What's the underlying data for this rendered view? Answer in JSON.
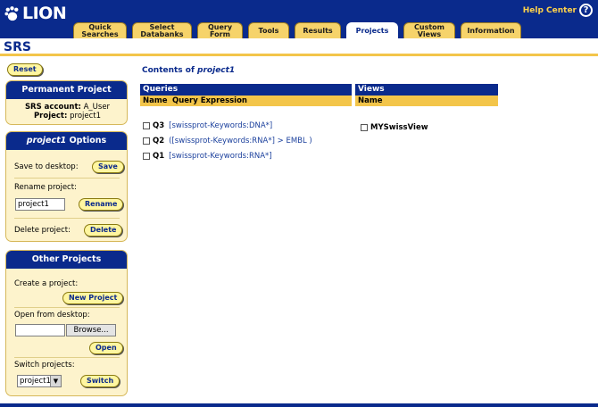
{
  "header": {
    "logo_text": "LION",
    "help_label": "Help Center",
    "help_icon": "?",
    "tabs": [
      {
        "label": "Quick\nSearches"
      },
      {
        "label": "Select\nDatabanks"
      },
      {
        "label": "Query\nForm"
      },
      {
        "label": "Tools"
      },
      {
        "label": "Results"
      },
      {
        "label": "Projects"
      },
      {
        "label": "Custom\nViews"
      },
      {
        "label": "Information"
      }
    ],
    "active_tab": "Projects"
  },
  "srs_title": "SRS",
  "reset_label": "Reset",
  "permanent": {
    "title": "Permanent Project",
    "account_label": "SRS account:",
    "account_value": "A_User",
    "project_label": "Project:",
    "project_value": "project1"
  },
  "options": {
    "title_name": "project1",
    "title_suffix": " Options",
    "save_label": "Save to desktop:",
    "save_button": "Save",
    "rename_label": "Rename project:",
    "rename_value": "project1",
    "rename_button": "Rename",
    "delete_label": "Delete project:",
    "delete_button": "Delete"
  },
  "other": {
    "title": "Other Projects",
    "create_label": "Create a project:",
    "new_button": "New Project",
    "open_label": "Open from desktop:",
    "browse_button": "Browse...",
    "open_button": "Open",
    "switch_label": "Switch projects:",
    "switch_value": "project1",
    "switch_button": "Switch"
  },
  "main": {
    "contents_prefix": "Contents of ",
    "contents_name": "project1",
    "queries_head": "Queries",
    "queries_col_name": "Name",
    "queries_col_expr": "Query Expression",
    "views_head": "Views",
    "views_col_name": "Name",
    "queries": [
      {
        "name": "Q3",
        "expr": "[swissprot-Keywords:DNA*]"
      },
      {
        "name": "Q2",
        "expr": "([swissprot-Keywords:RNA*] > EMBL )"
      },
      {
        "name": "Q1",
        "expr": "[swissprot-Keywords:RNA*]"
      }
    ],
    "views": [
      {
        "name": "MYSwissView"
      }
    ]
  },
  "colors": {
    "brand_blue": "#0a2a8c",
    "accent_gold": "#f3c54a",
    "panel_bg": "#fdf3cc"
  }
}
